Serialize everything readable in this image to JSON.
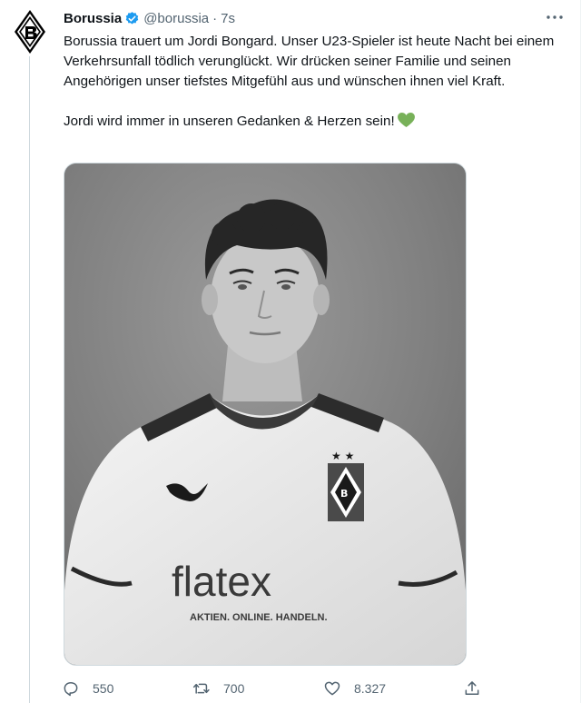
{
  "tweet": {
    "author_name": "Borussia",
    "handle": "@borussia",
    "separator": "·",
    "time": "7s",
    "text_paragraph_1": "Borussia trauert um Jordi Bongard. Unser U23-Spieler ist heute Nacht bei einem Verkehrsunfall tödlich verunglückt. Wir drücken seiner Familie und seinen Angehörigen unser tiefstes Mitgefühl aus und wünschen ihnen viel Kraft.",
    "text_paragraph_2": "Jordi wird immer in unseren Gedanken & Herzen sein!",
    "emoji": "green-heart",
    "photo": {
      "jersey_sponsor": "flatex",
      "jersey_slogan": "AKTIEN. ONLINE. HANDELN."
    }
  },
  "actions": {
    "replies": "550",
    "retweets": "700",
    "likes": "8.327"
  },
  "icons": [
    "borussia-logo-icon",
    "verified-badge-icon",
    "more-options-icon",
    "reply-icon",
    "retweet-icon",
    "like-icon",
    "share-icon",
    "green-heart-emoji-icon"
  ],
  "colors": {
    "verified": "#1d9bf0",
    "secondary_text": "#536471",
    "emoji_heart": "#78b159"
  }
}
